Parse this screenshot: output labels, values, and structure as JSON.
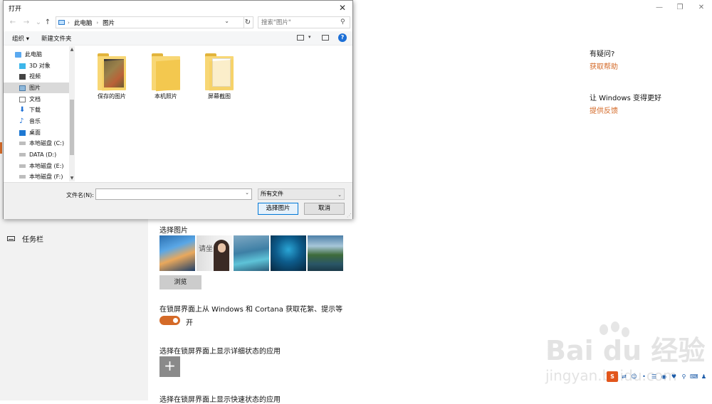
{
  "settings": {
    "window_controls": {
      "minimize": "—",
      "restore": "❐",
      "close": "✕"
    },
    "nav": {
      "taskbar_label": "任务栏"
    },
    "help": {
      "question": "有疑问?",
      "get_help": "获取帮助",
      "improve": "让 Windows 变得更好",
      "feedback": "提供反馈"
    },
    "choose_picture_label": "选择图片",
    "thumbnail_text": "请坐",
    "browse_label": "浏览",
    "fun_facts_label": "在锁屏界面上从 Windows 和 Cortana 获取花絮、提示等",
    "toggle_state": "开",
    "detailed_status_label": "选择在锁屏界面上显示详细状态的应用",
    "add_label": "+",
    "quick_status_label": "选择在锁屏界面上显示快速状态的应用",
    "accent_color": "#d46a28"
  },
  "watermark": {
    "text": "Bai du 经验",
    "url": "jingyan.baidu.com"
  },
  "tray": {
    "ime_label": "S"
  },
  "dialog": {
    "title": "打开",
    "close": "✕",
    "nav": {
      "back": "←",
      "forward": "→",
      "recent": "⌄",
      "up": "↑"
    },
    "breadcrumb": [
      "此电脑",
      "图片"
    ],
    "refresh": "↻",
    "search_placeholder": "搜索\"图片\"",
    "toolbar": {
      "organize": "组织 ▾",
      "new_folder": "新建文件夹",
      "help": "?"
    },
    "tree": [
      {
        "label": "此电脑",
        "icon": "pc-icon"
      },
      {
        "label": "3D 对象",
        "icon": "cube-icon"
      },
      {
        "label": "视频",
        "icon": "video-icon"
      },
      {
        "label": "图片",
        "icon": "picture-icon",
        "selected": true
      },
      {
        "label": "文档",
        "icon": "document-icon"
      },
      {
        "label": "下载",
        "icon": "download-icon"
      },
      {
        "label": "音乐",
        "icon": "music-icon"
      },
      {
        "label": "桌面",
        "icon": "desktop-icon"
      },
      {
        "label": "本地磁盘 (C:)",
        "icon": "drive-icon"
      },
      {
        "label": "DATA (D:)",
        "icon": "drive-icon"
      },
      {
        "label": "本地磁盘 (E:)",
        "icon": "drive-icon"
      },
      {
        "label": "本地磁盘 (F:)",
        "icon": "drive-icon"
      }
    ],
    "files": [
      {
        "label": "保存的图片",
        "kind": "photo"
      },
      {
        "label": "本机照片",
        "kind": "plain"
      },
      {
        "label": "屏幕截图",
        "kind": "paper"
      }
    ],
    "filename_label": "文件名(N):",
    "filename_value": "",
    "filetype": "所有文件",
    "open_button": "选择图片",
    "cancel_button": "取消"
  }
}
